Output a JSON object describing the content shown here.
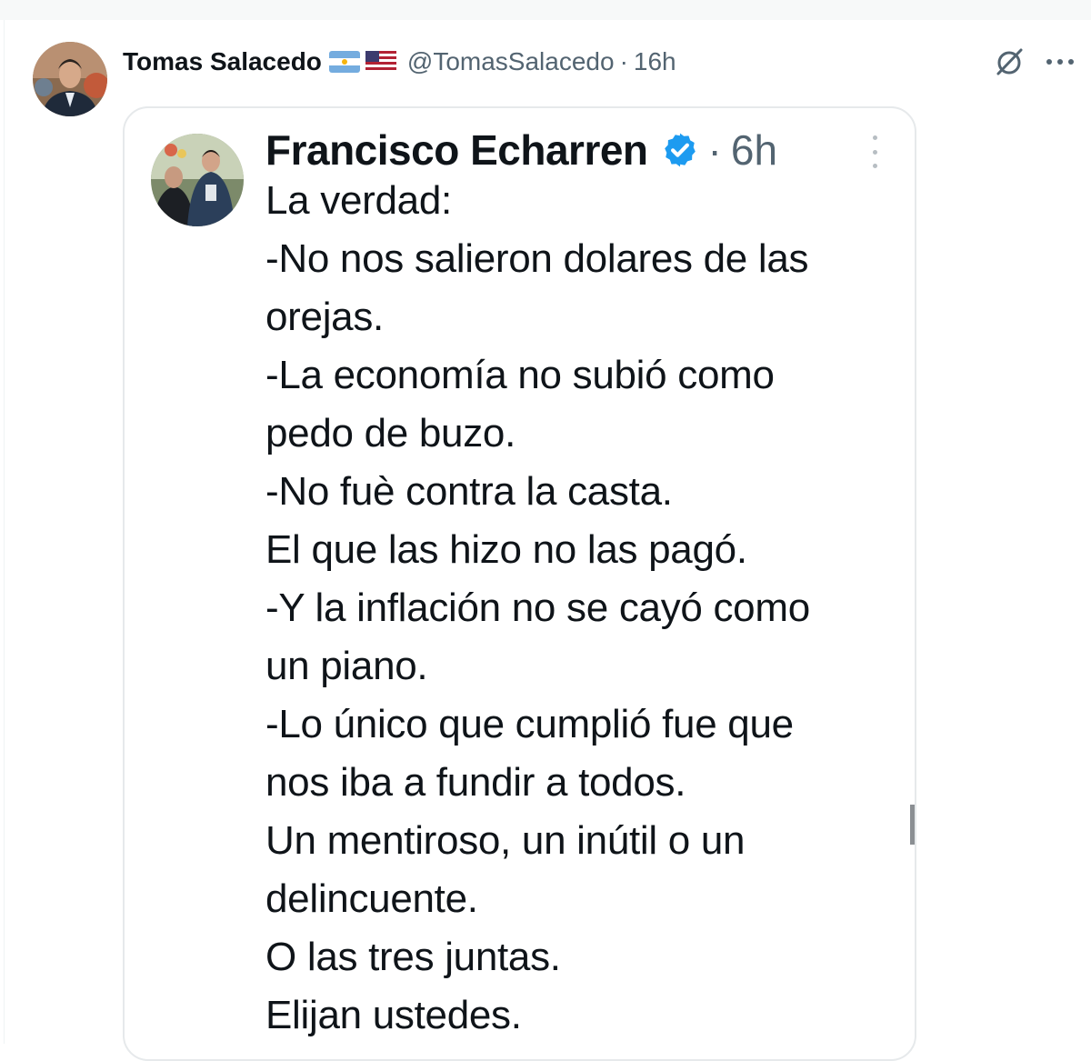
{
  "tweet": {
    "author_name": "Tomas Salacedo",
    "flags": [
      "argentina-flag",
      "usa-flag"
    ],
    "handle": "@TomasSalacedo",
    "separator": "·",
    "time": "16h",
    "icons": [
      "grok-icon",
      "more-icon"
    ]
  },
  "quoted": {
    "author_name": "Francisco Echarren",
    "verified": true,
    "separator": "·",
    "time": "6h",
    "lines": [
      "La verdad:",
      "-No nos salieron dolares de las",
      "orejas.",
      "-La economía no subió como",
      "pedo de buzo.",
      "-No fuè contra la casta.",
      "El que las hizo no las pagó.",
      "-Y la inflación no se cayó como",
      "un piano.",
      "-Lo único que cumplió fue que",
      "nos iba a fundir a todos.",
      "Un mentiroso, un inútil o un",
      "delincuente.",
      "O las tres juntas.",
      "Elijan ustedes."
    ]
  },
  "colors": {
    "text": "#0f1419",
    "secondary": "#536471",
    "verified": "#1d9bf0",
    "border": "#e6e9eb"
  }
}
